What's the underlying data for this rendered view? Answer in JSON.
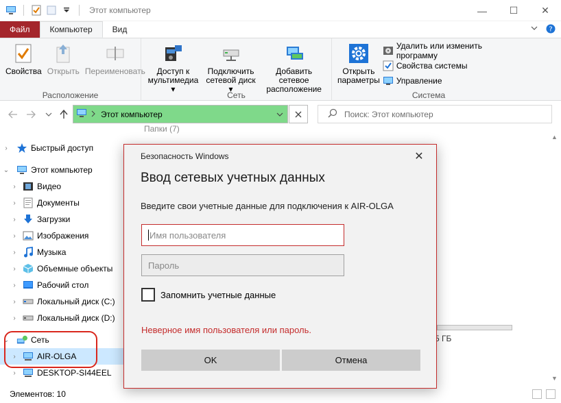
{
  "window": {
    "title": "Этот компьютер",
    "minimize": "—",
    "maximize": "☐",
    "close": "✕"
  },
  "tabs": {
    "file": "Файл",
    "computer": "Компьютер",
    "view": "Вид"
  },
  "ribbon": {
    "location": {
      "label": "Расположение",
      "properties": "Свойства",
      "open": "Открыть",
      "rename": "Переименовать"
    },
    "network": {
      "label": "Сеть",
      "media_line1": "Доступ к",
      "media_line2": "мультимедиа ▾",
      "drive_line1": "Подключить",
      "drive_line2": "сетевой диск ▾",
      "addloc_line1": "Добавить сетевое",
      "addloc_line2": "расположение"
    },
    "system": {
      "label": "Система",
      "open_line1": "Открыть",
      "open_line2": "параметры",
      "uninstall": "Удалить или изменить программу",
      "sysprops": "Свойства системы",
      "manage": "Управление"
    }
  },
  "address": {
    "path": "Этот компьютер",
    "search_placeholder": "Поиск: Этот компьютер"
  },
  "navpane": {
    "quick_access": "Быстрый доступ",
    "this_pc": "Этот компьютер",
    "video": "Видео",
    "documents": "Документы",
    "downloads": "Загрузки",
    "pictures": "Изображения",
    "music": "Музыка",
    "objects3d": "Объемные объекты",
    "desktop": "Рабочий стол",
    "disk_c": "Локальный диск (C:)",
    "disk_d": "Локальный диск (D:)",
    "network": "Сеть",
    "air_olga": "AIR-OLGA",
    "desktop_si": "DESKTOP-SI44EEL"
  },
  "content": {
    "folders_partial": "Папки (7)",
    "size_partial": "5 ГБ"
  },
  "status": {
    "items": "Элементов: 10"
  },
  "dialog": {
    "header": "Безопасность Windows",
    "title": "Ввод сетевых учетных данных",
    "description": "Введите свои учетные данные для подключения к AIR-OLGA",
    "username_placeholder": "Имя пользователя",
    "password_placeholder": "Пароль",
    "remember": "Запомнить учетные данные",
    "error": "Неверное имя пользователя или пароль.",
    "ok": "OK",
    "cancel": "Отмена",
    "close": "✕"
  },
  "colors": {
    "file_tab": "#a4262c",
    "address_bg": "#7fd98a",
    "error": "#c42b2b",
    "highlight_circle": "#d9261c"
  }
}
